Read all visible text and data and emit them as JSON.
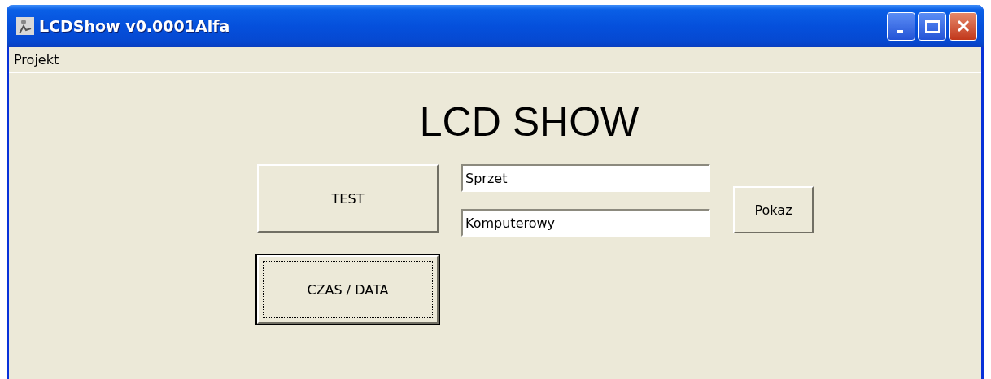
{
  "window": {
    "title": "LCDShow v0.0001Alfa"
  },
  "menu": [
    {
      "label": "Projekt"
    }
  ],
  "heading": "LCD SHOW",
  "left_buttons": [
    {
      "label": "TEST",
      "focused": false
    },
    {
      "label": "CZAS / DATA",
      "focused": true
    }
  ],
  "fields": [
    {
      "value": "Sprzet"
    },
    {
      "value": "Komputerowy"
    }
  ],
  "right_button": {
    "label": "Pokaz",
    "focused": false
  }
}
